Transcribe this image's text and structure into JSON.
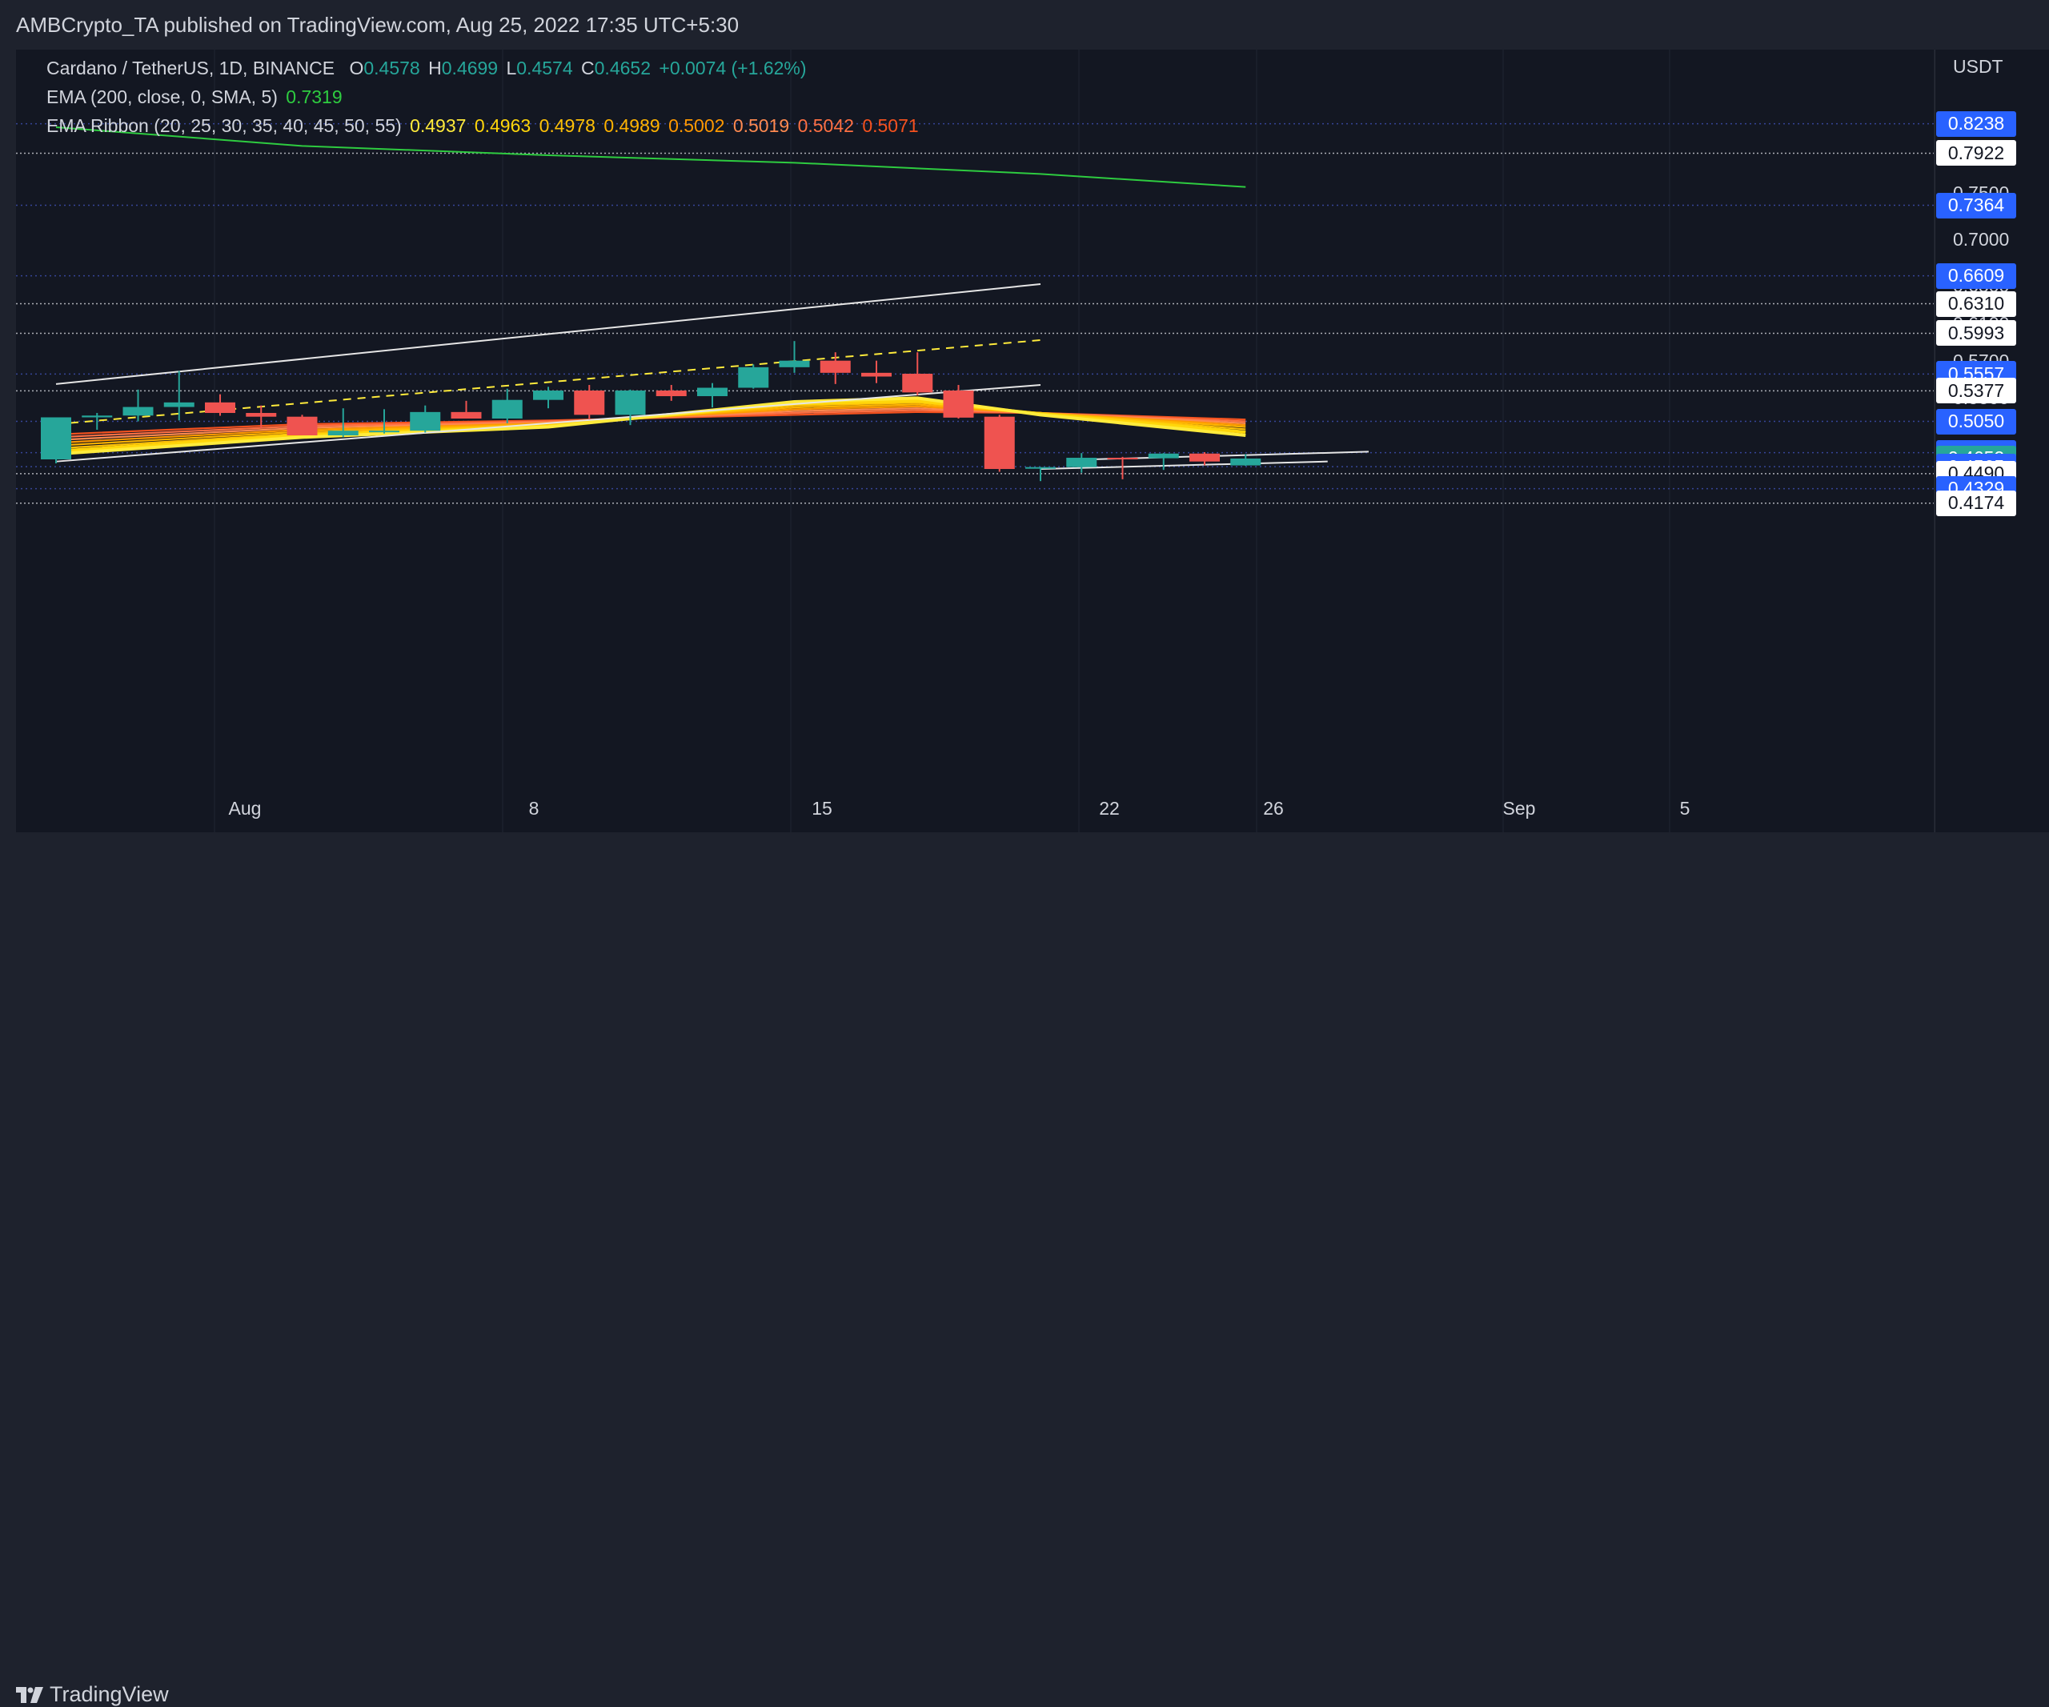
{
  "header": {
    "publish_line": "AMBCrypto_TA published on TradingView.com, Aug 25, 2022 17:35 UTC+5:30"
  },
  "legend": {
    "symbol": "Cardano / TetherUS, 1D, BINANCE",
    "o_label": "O",
    "o_value": "0.4578",
    "h_label": "H",
    "h_value": "0.4699",
    "l_label": "L",
    "l_value": "0.4574",
    "c_label": "C",
    "c_value": "0.4652",
    "change": "+0.0074 (+1.62%)",
    "ema_label": "EMA (200, close, 0, SMA, 5)",
    "ema_value": "0.7319",
    "ribbon_label": "EMA Ribbon (20, 25, 30, 35, 40, 45, 50, 55)",
    "ribbon_values": [
      "0.4937",
      "0.4963",
      "0.4978",
      "0.4989",
      "0.5002",
      "0.5019",
      "0.5042",
      "0.5071"
    ]
  },
  "colors": {
    "up": "#26a69a",
    "down": "#ef5350",
    "ema": "#2ecc40",
    "ribbon": [
      "#ffeb3b",
      "#ffd60a",
      "#ffc107",
      "#ffb300",
      "#ff9800",
      "#ff8a50",
      "#ff7043",
      "#f4511e"
    ],
    "ribbon_text": [
      "#ffeb3b",
      "#ffd60a",
      "#ffc107",
      "#ffb300",
      "#ff9800",
      "#ff8a50",
      "#ff7043",
      "#f4511e"
    ]
  },
  "price_axis": {
    "currency": "USDT",
    "ticks": [
      "0.7500",
      "0.7000",
      "0.6500",
      "0.6100",
      "0.5700",
      "0.5300",
      "0.5000"
    ],
    "badges": [
      {
        "value": "0.8238",
        "price": 0.8238,
        "style": "blue"
      },
      {
        "value": "0.7922",
        "price": 0.7922,
        "style": "white"
      },
      {
        "value": "0.7364",
        "price": 0.7364,
        "style": "blue"
      },
      {
        "value": "0.6609",
        "price": 0.6609,
        "style": "blue"
      },
      {
        "value": "0.6310",
        "price": 0.631,
        "style": "white"
      },
      {
        "value": "0.5993",
        "price": 0.5993,
        "style": "white"
      },
      {
        "value": "0.5557",
        "price": 0.5557,
        "style": "blue"
      },
      {
        "value": "0.5377",
        "price": 0.5377,
        "style": "white"
      },
      {
        "value": "0.5050",
        "price": 0.505,
        "style": "blue"
      },
      {
        "value": "0.4715",
        "price": 0.4715,
        "style": "blue"
      },
      {
        "value": "0.4652",
        "price": 0.4652,
        "style": "green"
      },
      {
        "value": "0.4565",
        "price": 0.4565,
        "style": "blue"
      },
      {
        "value": "0.4490",
        "price": 0.449,
        "style": "white"
      },
      {
        "value": "0.4329",
        "price": 0.4329,
        "style": "blue"
      },
      {
        "value": "0.4174",
        "price": 0.4174,
        "style": "white"
      }
    ]
  },
  "time_axis": {
    "labels": [
      "Aug",
      "8",
      "15",
      "22",
      "26",
      "Sep",
      "5"
    ]
  },
  "footer": {
    "brand": "TradingView"
  },
  "chart_data": {
    "type": "candlestick",
    "symbol": "ADA/USDT",
    "interval": "1D",
    "ylim": [
      0.405,
      0.835
    ],
    "candles": [
      {
        "date": "2022-07-31",
        "o": 0.4643,
        "h": 0.5093,
        "l": 0.46,
        "c": 0.5093
      },
      {
        "date": "2022-08-01",
        "o": 0.5093,
        "h": 0.514,
        "l": 0.496,
        "c": 0.5112
      },
      {
        "date": "2022-08-02",
        "o": 0.5112,
        "h": 0.539,
        "l": 0.505,
        "c": 0.5204
      },
      {
        "date": "2022-08-03",
        "o": 0.5204,
        "h": 0.559,
        "l": 0.506,
        "c": 0.5253
      },
      {
        "date": "2022-08-04",
        "o": 0.5253,
        "h": 0.534,
        "l": 0.511,
        "c": 0.514
      },
      {
        "date": "2022-08-05",
        "o": 0.514,
        "h": 0.522,
        "l": 0.498,
        "c": 0.51
      },
      {
        "date": "2022-08-06",
        "o": 0.51,
        "h": 0.512,
        "l": 0.493,
        "c": 0.49
      },
      {
        "date": "2022-08-07",
        "o": 0.49,
        "h": 0.519,
        "l": 0.488,
        "c": 0.495
      },
      {
        "date": "2022-08-08",
        "o": 0.495,
        "h": 0.518,
        "l": 0.492,
        "c": 0.495
      },
      {
        "date": "2022-08-09",
        "o": 0.495,
        "h": 0.522,
        "l": 0.493,
        "c": 0.515
      },
      {
        "date": "2022-08-10",
        "o": 0.515,
        "h": 0.527,
        "l": 0.508,
        "c": 0.508
      },
      {
        "date": "2022-08-11",
        "o": 0.508,
        "h": 0.54,
        "l": 0.503,
        "c": 0.528
      },
      {
        "date": "2022-08-12",
        "o": 0.528,
        "h": 0.542,
        "l": 0.519,
        "c": 0.538
      },
      {
        "date": "2022-08-13",
        "o": 0.538,
        "h": 0.544,
        "l": 0.507,
        "c": 0.512
      },
      {
        "date": "2022-08-14",
        "o": 0.512,
        "h": 0.539,
        "l": 0.501,
        "c": 0.538
      },
      {
        "date": "2022-08-15",
        "o": 0.538,
        "h": 0.544,
        "l": 0.527,
        "c": 0.532
      },
      {
        "date": "2022-08-16",
        "o": 0.532,
        "h": 0.546,
        "l": 0.52,
        "c": 0.541
      },
      {
        "date": "2022-08-17",
        "o": 0.541,
        "h": 0.566,
        "l": 0.54,
        "c": 0.563
      },
      {
        "date": "2022-08-18",
        "o": 0.563,
        "h": 0.591,
        "l": 0.557,
        "c": 0.57
      },
      {
        "date": "2022-08-19",
        "o": 0.57,
        "h": 0.579,
        "l": 0.545,
        "c": 0.557
      },
      {
        "date": "2022-08-20",
        "o": 0.557,
        "h": 0.57,
        "l": 0.546,
        "c": 0.553
      },
      {
        "date": "2022-08-21",
        "o": 0.556,
        "h": 0.579,
        "l": 0.533,
        "c": 0.536
      },
      {
        "date": "2022-08-22",
        "o": 0.538,
        "h": 0.544,
        "l": 0.508,
        "c": 0.509
      },
      {
        "date": "2022-08-23",
        "o": 0.51,
        "h": 0.512,
        "l": 0.451,
        "c": 0.454
      },
      {
        "date": "2022-08-24",
        "o": 0.4545,
        "h": 0.456,
        "l": 0.441,
        "c": 0.456
      },
      {
        "date": "2022-08-25",
        "o": 0.456,
        "h": 0.471,
        "l": 0.45,
        "c": 0.466
      },
      {
        "date": "2022-08-26",
        "o": 0.466,
        "h": 0.467,
        "l": 0.443,
        "c": 0.4655
      },
      {
        "date": "2022-08-27",
        "o": 0.4655,
        "h": 0.471,
        "l": 0.453,
        "c": 0.4705
      },
      {
        "date": "2022-08-28",
        "o": 0.4705,
        "h": 0.472,
        "l": 0.458,
        "c": 0.462
      },
      {
        "date": "2022-08-29",
        "o": 0.4578,
        "h": 0.4699,
        "l": 0.4574,
        "c": 0.4652
      }
    ],
    "ema200": [
      [
        0,
        0.82
      ],
      [
        6,
        0.8
      ],
      [
        12,
        0.79
      ],
      [
        18,
        0.782
      ],
      [
        24,
        0.77
      ],
      [
        29,
        0.756
      ]
    ],
    "ribbon": [
      {
        "name": "EMA 20",
        "points": [
          [
            0,
            0.47
          ],
          [
            6,
            0.488
          ],
          [
            12,
            0.499
          ],
          [
            18,
            0.526
          ],
          [
            21,
            0.53
          ],
          [
            24,
            0.512
          ],
          [
            29,
            0.49
          ]
        ]
      },
      {
        "name": "EMA 25",
        "points": [
          [
            0,
            0.473
          ],
          [
            6,
            0.49
          ],
          [
            12,
            0.5
          ],
          [
            18,
            0.524
          ],
          [
            21,
            0.527
          ],
          [
            24,
            0.513
          ],
          [
            29,
            0.4935
          ]
        ]
      },
      {
        "name": "EMA 30",
        "points": [
          [
            0,
            0.476
          ],
          [
            6,
            0.492
          ],
          [
            12,
            0.501
          ],
          [
            18,
            0.522
          ],
          [
            21,
            0.525
          ],
          [
            24,
            0.514
          ],
          [
            29,
            0.4965
          ]
        ]
      },
      {
        "name": "EMA 35",
        "points": [
          [
            0,
            0.479
          ],
          [
            6,
            0.494
          ],
          [
            12,
            0.502
          ],
          [
            18,
            0.52
          ],
          [
            21,
            0.523
          ],
          [
            24,
            0.514
          ],
          [
            29,
            0.499
          ]
        ]
      },
      {
        "name": "EMA 40",
        "points": [
          [
            0,
            0.482
          ],
          [
            6,
            0.496
          ],
          [
            12,
            0.503
          ],
          [
            18,
            0.518
          ],
          [
            21,
            0.521
          ],
          [
            24,
            0.514
          ],
          [
            29,
            0.501
          ]
        ]
      },
      {
        "name": "EMA 45",
        "points": [
          [
            0,
            0.485
          ],
          [
            6,
            0.498
          ],
          [
            12,
            0.504
          ],
          [
            18,
            0.516
          ],
          [
            21,
            0.519
          ],
          [
            24,
            0.514
          ],
          [
            29,
            0.503
          ]
        ]
      },
      {
        "name": "EMA 50",
        "points": [
          [
            0,
            0.488
          ],
          [
            6,
            0.5
          ],
          [
            12,
            0.505
          ],
          [
            18,
            0.514
          ],
          [
            21,
            0.517
          ],
          [
            24,
            0.514
          ],
          [
            29,
            0.505
          ]
        ]
      },
      {
        "name": "EMA 55",
        "points": [
          [
            0,
            0.491
          ],
          [
            6,
            0.502
          ],
          [
            12,
            0.506
          ],
          [
            18,
            0.512
          ],
          [
            21,
            0.515
          ],
          [
            24,
            0.514
          ],
          [
            29,
            0.507
          ]
        ]
      }
    ],
    "trendlines": [
      {
        "style": "white",
        "points": [
          [
            0,
            0.462
          ],
          [
            24,
            0.544
          ]
        ]
      },
      {
        "style": "white",
        "points": [
          [
            0,
            0.545
          ],
          [
            24,
            0.652
          ]
        ]
      },
      {
        "style": "yellow-dashed",
        "points": [
          [
            0,
            0.502
          ],
          [
            24,
            0.592
          ]
        ]
      },
      {
        "style": "white",
        "points": [
          [
            24,
            0.454
          ],
          [
            31,
            0.462
          ]
        ]
      },
      {
        "style": "white",
        "points": [
          [
            25,
            0.464
          ],
          [
            32,
            0.4725
          ]
        ]
      }
    ],
    "horizontal_levels": [
      0.8238,
      0.7922,
      0.7364,
      0.6609,
      0.631,
      0.5993,
      0.5557,
      0.5377,
      0.505,
      0.4715,
      0.4565,
      0.449,
      0.4329,
      0.4174
    ]
  }
}
